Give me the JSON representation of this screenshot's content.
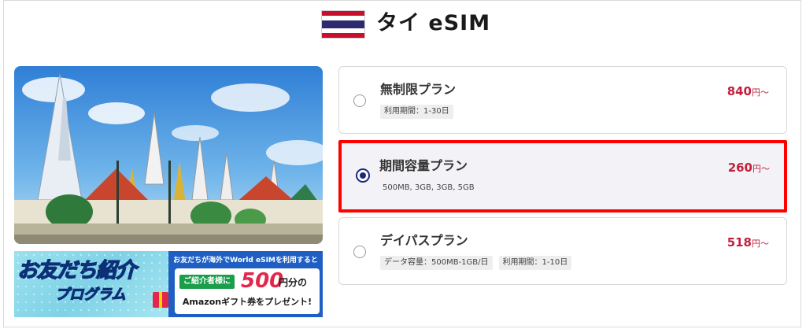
{
  "header": {
    "flag_icon": "thailand-flag",
    "title": "タイ eSIM"
  },
  "banner": {
    "main_text": "お友だち紹介",
    "sub_text": "プログラム",
    "top_text": "お友だちが海外でWorld eSIMを利用すると",
    "pill_text": "ご紹介者様に",
    "amount": "500",
    "amount_suffix": "円分の",
    "bottom_text": "Amazonギフト券をプレゼント!"
  },
  "plans": [
    {
      "name": "無制限プラン",
      "price": "840",
      "price_suffix": "円〜",
      "tags": [
        "利用期間：1-30日"
      ],
      "selected": false
    },
    {
      "name": "期間容量プラン",
      "price": "260",
      "price_suffix": "円〜",
      "tags": [
        "500MB, 3GB, 3GB, 5GB"
      ],
      "selected": true
    },
    {
      "name": "デイパスプラン",
      "price": "518",
      "price_suffix": "円〜",
      "tags": [
        "データ容量：500MB-1GB/日",
        "利用期間：1-10日"
      ],
      "selected": false
    }
  ],
  "colors": {
    "price": "#c0203c",
    "highlight_border": "#ff0000",
    "radio_selected": "#1b2a7a"
  }
}
